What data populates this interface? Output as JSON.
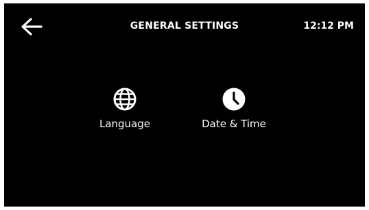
{
  "header": {
    "title": "GENERAL SETTINGS",
    "time": "12:12 PM",
    "back_icon": "arrow-left-icon"
  },
  "tiles": [
    {
      "label": "Language",
      "icon": "globe-icon"
    },
    {
      "label": "Date & Time",
      "icon": "clock-icon"
    }
  ],
  "colors": {
    "background": "#000000",
    "foreground": "#ffffff"
  }
}
